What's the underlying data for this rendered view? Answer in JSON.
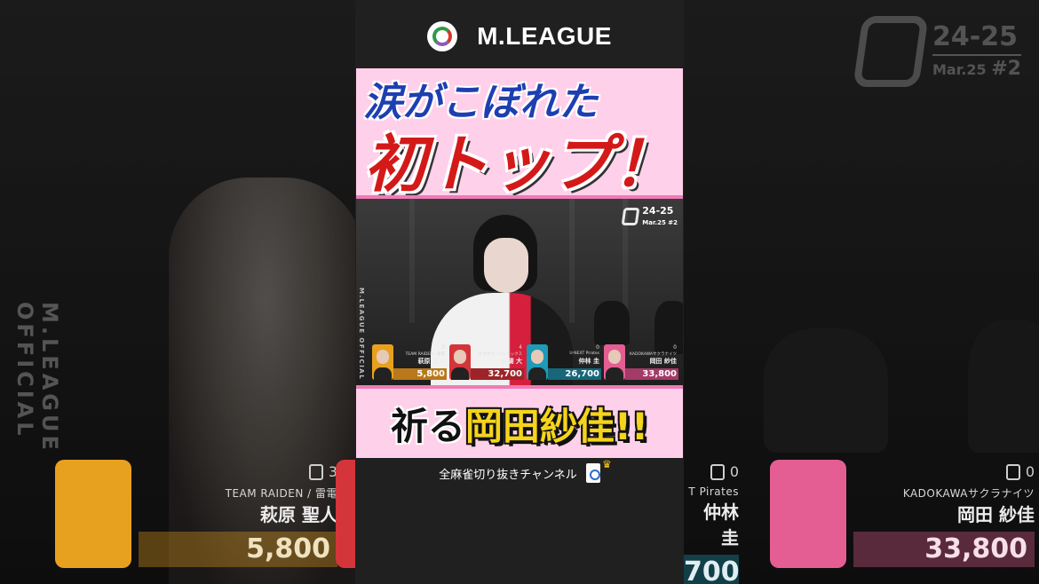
{
  "brand": {
    "title": "M.LEAGUE"
  },
  "headline": {
    "line1": "涙がこぼれた",
    "line2": "初トップ！"
  },
  "caption": {
    "prefix": "祈る",
    "highlight": "岡田紗佳!!"
  },
  "channel": {
    "label": "全麻雀切り抜きチャンネル"
  },
  "broadcast": {
    "season": "24-25",
    "date": "Mar.25",
    "game": "#2",
    "vertical_tag": "M.LEAGUE OFFICIAL"
  },
  "players": [
    {
      "seat": "3",
      "team": "TEAM RAIDEN / 雷電",
      "name": "萩原 聖人",
      "score": "5,800",
      "color": "#e8a11e"
    },
    {
      "seat": "4",
      "team": "セガサミーフェニックス",
      "name": "醍醐 大",
      "score": "32,700",
      "color": "#d4353a"
    },
    {
      "seat": "0",
      "team": "U-NEXT Pirates",
      "name": "仲林 圭",
      "score": "26,700",
      "color": "#1d9bb8"
    },
    {
      "seat": "0",
      "team": "KADOKAWAサクラナイツ",
      "name": "岡田 紗佳",
      "score": "33,800",
      "color": "#e45e93"
    }
  ],
  "side_cards": {
    "left": {
      "seat": "3",
      "team": "TEAM RAIDEN / 雷電",
      "name": "萩原 聖人",
      "score": "5,800"
    },
    "right_partial": {
      "seat": "0",
      "team": "T Pirates",
      "name": "仲林 圭",
      "score": "700"
    },
    "right": {
      "seat": "0",
      "team": "KADOKAWAサクラナイツ",
      "name": "岡田 紗佳",
      "score": "33,800"
    }
  },
  "colors": {
    "banner_pink": "#ffd0ea",
    "headline_blue": "#1e3fb0",
    "headline_red": "#d41919",
    "caption_yellow": "#f4d41c"
  }
}
